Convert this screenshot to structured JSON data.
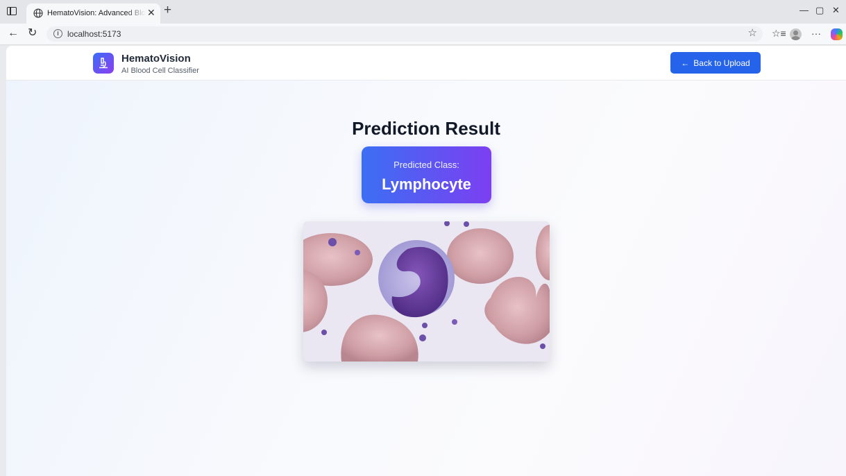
{
  "browser": {
    "tab_title": "HematoVision: Advanced Blood C",
    "url": "localhost:5173"
  },
  "header": {
    "brand_name": "HematoVision",
    "brand_subtitle": "AI Blood Cell Classifier",
    "back_button_label": "Back to Upload"
  },
  "main": {
    "title": "Prediction Result",
    "predicted_label": "Predicted Class:",
    "predicted_class": "Lymphocyte"
  },
  "icons": [
    "sidebar-toggle-icon",
    "globe-icon",
    "close-icon",
    "plus-icon",
    "back-icon",
    "reload-icon",
    "info-icon",
    "star-icon",
    "favorites-icon",
    "profile-icon",
    "more-icon",
    "copilot-icon",
    "microscope-icon",
    "arrow-left-icon"
  ],
  "colors": {
    "accent": "#2563eb",
    "gradient_start": "#3b6ff3",
    "gradient_end": "#7c3ff1"
  }
}
